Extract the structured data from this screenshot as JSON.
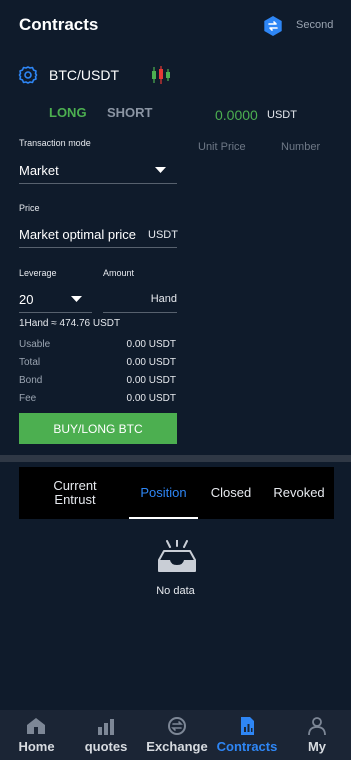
{
  "header": {
    "title": "Contracts",
    "second_label": "Second"
  },
  "pair": {
    "name": "BTC/USDT"
  },
  "direction_tabs": {
    "long": "LONG",
    "short": "SHORT"
  },
  "price": {
    "value": "0.0000",
    "unit": "USDT"
  },
  "order_book": {
    "col_price": "Unit Price",
    "col_number": "Number"
  },
  "form": {
    "transaction_mode_label": "Transaction mode",
    "transaction_mode_value": "Market",
    "price_label": "Price",
    "price_value": "Market optimal price",
    "price_unit": "USDT",
    "leverage_label": "Leverage",
    "leverage_value": "20",
    "amount_label": "Amount",
    "amount_unit": "Hand",
    "hand_note": "1Hand ≈ 474.76 USDT"
  },
  "stats": [
    {
      "label": "Usable",
      "value": "0.00 USDT"
    },
    {
      "label": "Total",
      "value": "0.00 USDT"
    },
    {
      "label": "Bond",
      "value": "0.00 USDT"
    },
    {
      "label": "Fee",
      "value": "0.00 USDT"
    }
  ],
  "buy_button": "BUY/LONG BTC",
  "order_tabs": [
    {
      "label": "Current Entrust"
    },
    {
      "label": "Position"
    },
    {
      "label": "Closed"
    },
    {
      "label": "Revoked"
    }
  ],
  "empty_state": "No data",
  "nav": [
    {
      "label": "Home",
      "icon": "home-icon"
    },
    {
      "label": "quotes",
      "icon": "chart-icon"
    },
    {
      "label": "Exchange",
      "icon": "exchange-icon"
    },
    {
      "label": "Contracts",
      "icon": "document-chart-icon"
    },
    {
      "label": "My",
      "icon": "user-icon"
    }
  ],
  "colors": {
    "accent": "#2e86f5",
    "long": "#4caf50",
    "background": "#0f1b2b"
  }
}
